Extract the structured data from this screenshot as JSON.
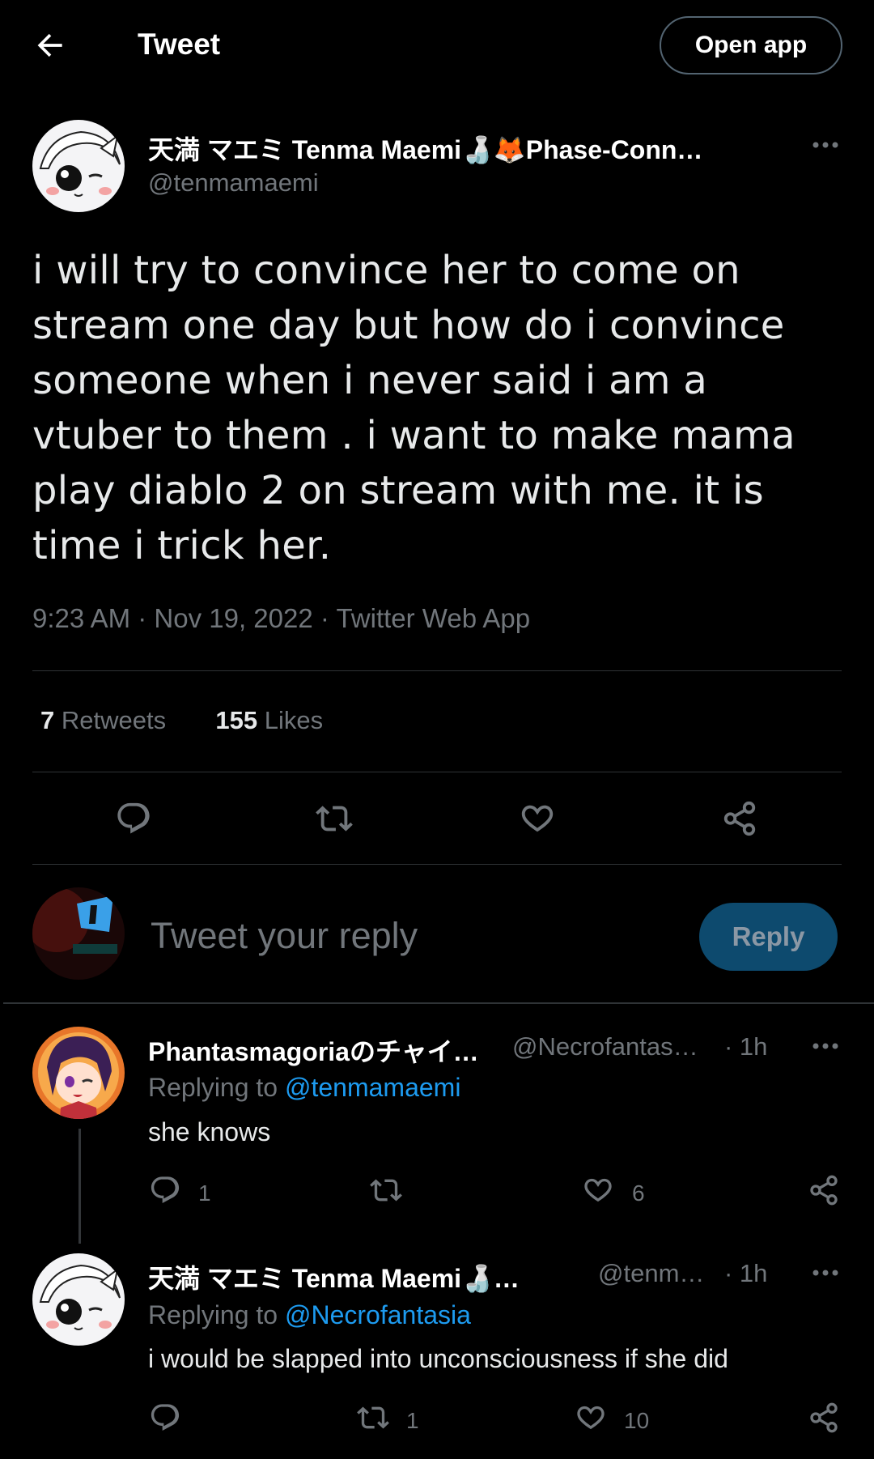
{
  "header": {
    "title": "Tweet",
    "open_app_label": "Open app"
  },
  "tweet": {
    "display_name": "天満 マエミ Tenma Maemi🍶🦊Phase-Conn…",
    "handle": "@tenmamaemi",
    "text": "i will try to convince her to come on stream one day but how do i convince someone when i never said i am a vtuber to them . i want to make mama play diablo 2 on stream with me. it is time i trick her.",
    "meta": "9:23 AM · Nov 19, 2022 · Twitter Web App",
    "retweets_count": "7",
    "retweets_label": "Retweets",
    "likes_count": "155",
    "likes_label": "Likes"
  },
  "composer": {
    "placeholder": "Tweet your reply",
    "reply_label": "Reply"
  },
  "replies": [
    {
      "display_name": "Phantasmagoriaのチャイ…",
      "handle": "@Necrofantas…",
      "time": "· 1h",
      "replying_prefix": "Replying to",
      "replying_to": "@tenmamaemi",
      "text": "she knows",
      "reply_count": "1",
      "retweet_count": "",
      "like_count": "6"
    },
    {
      "display_name": "天満 マエミ Tenma Maemi🍶…",
      "handle": "@tenm…",
      "time": "· 1h",
      "replying_prefix": "Replying to",
      "replying_to": "@Necrofantasia",
      "text": "i would be slapped into unconsciousness if she did",
      "reply_count": "",
      "retweet_count": "1",
      "like_count": "10"
    }
  ],
  "colors": {
    "background": "#000000",
    "link": "#1d9bf0",
    "muted": "#71767b",
    "reply_button": "#0d4a6e"
  },
  "icons": [
    "back-arrow-icon",
    "more-icon",
    "reply-icon",
    "retweet-icon",
    "like-icon",
    "share-icon"
  ]
}
